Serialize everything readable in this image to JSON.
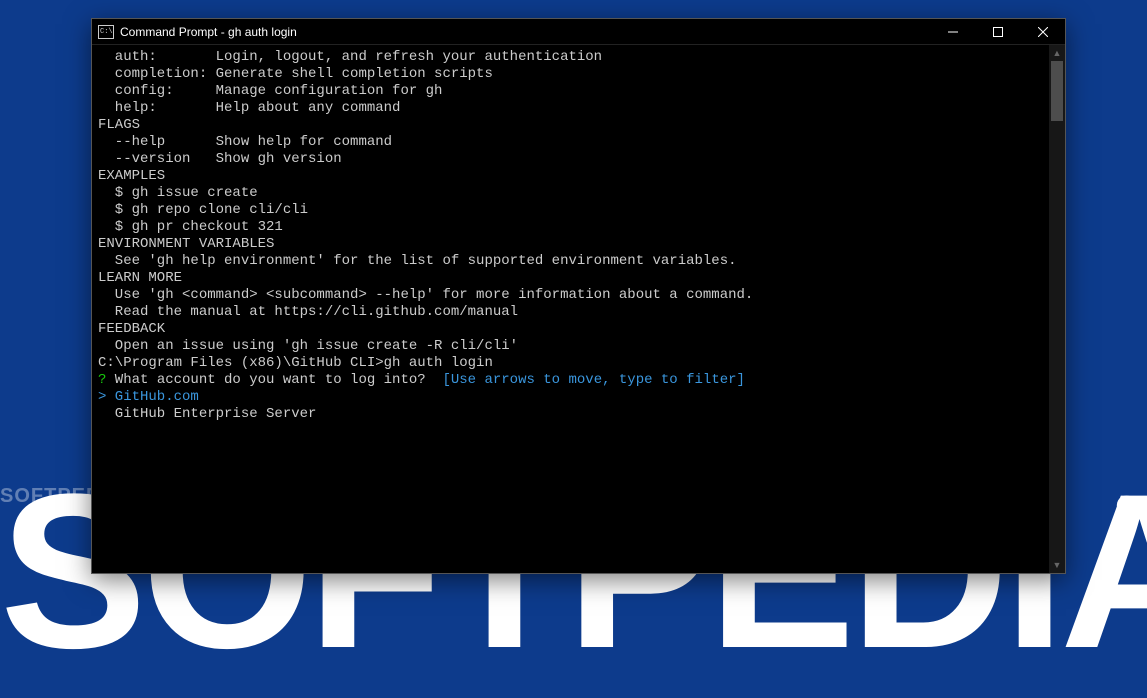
{
  "background": {
    "brand_text": "SOFTPEDIA",
    "watermark_left": "SOFTPEDIA",
    "watermark_sup": "®",
    "watermark_right": "®"
  },
  "window": {
    "title": "Command Prompt - gh  auth login"
  },
  "terminal": {
    "commands": [
      {
        "name": "auth:",
        "pad": "       ",
        "desc": "Login, logout, and refresh your authentication"
      },
      {
        "name": "completion:",
        "pad": " ",
        "desc": "Generate shell completion scripts"
      },
      {
        "name": "config:",
        "pad": "     ",
        "desc": "Manage configuration for gh"
      },
      {
        "name": "help:",
        "pad": "       ",
        "desc": "Help about any command"
      }
    ],
    "flags_header": "FLAGS",
    "flags": [
      {
        "name": "--help",
        "pad": "      ",
        "desc": "Show help for command"
      },
      {
        "name": "--version",
        "pad": "   ",
        "desc": "Show gh version"
      }
    ],
    "examples_header": "EXAMPLES",
    "examples": [
      "$ gh issue create",
      "$ gh repo clone cli/cli",
      "$ gh pr checkout 321"
    ],
    "env_header": "ENVIRONMENT VARIABLES",
    "env_text": "See 'gh help environment' for the list of supported environment variables.",
    "learn_header": "LEARN MORE",
    "learn_lines": [
      "Use 'gh <command> <subcommand> --help' for more information about a command.",
      "Read the manual at https://cli.github.com/manual"
    ],
    "feedback_header": "FEEDBACK",
    "feedback_text": "Open an issue using 'gh issue create -R cli/cli'",
    "prompt_path": "C:\\Program Files (x86)\\GitHub CLI>",
    "prompt_cmd": "gh auth login",
    "survey_mark": "?",
    "survey_question": "What account do you want to log into?",
    "survey_hint": "[Use arrows to move, type to filter]",
    "selected_marker": ">",
    "choice_selected": "GitHub.com",
    "choice_other": "GitHub Enterprise Server"
  }
}
